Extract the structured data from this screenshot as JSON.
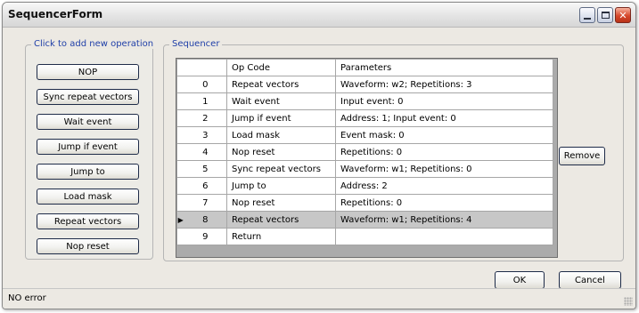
{
  "window": {
    "title": "SequencerForm"
  },
  "operations": {
    "label": "Click to add new operation",
    "buttons": [
      "NOP",
      "Sync repeat vectors",
      "Wait event",
      "Jump if event",
      "Jump to",
      "Load mask",
      "Repeat vectors",
      "Nop reset"
    ]
  },
  "sequencer": {
    "label": "Sequencer",
    "columns": {
      "opcode": "Op Code",
      "parameters": "Parameters"
    },
    "rows": [
      {
        "index": "0",
        "opcode": "Repeat vectors",
        "params": "Waveform: w2; Repetitions: 3"
      },
      {
        "index": "1",
        "opcode": "Wait event",
        "params": "Input event: 0"
      },
      {
        "index": "2",
        "opcode": "Jump if event",
        "params": "Address: 1; Input event: 0"
      },
      {
        "index": "3",
        "opcode": "Load mask",
        "params": "Event mask: 0"
      },
      {
        "index": "4",
        "opcode": "Nop reset",
        "params": "Repetitions: 0"
      },
      {
        "index": "5",
        "opcode": "Sync repeat vectors",
        "params": "Waveform: w1; Repetitions: 0"
      },
      {
        "index": "6",
        "opcode": "Jump to",
        "params": "Address: 2"
      },
      {
        "index": "7",
        "opcode": "Nop reset",
        "params": "Repetitions: 0"
      },
      {
        "index": "8",
        "opcode": "Repeat vectors",
        "params": "Waveform: w1; Repetitions: 4"
      },
      {
        "index": "9",
        "opcode": "Return",
        "params": ""
      }
    ],
    "selected_row": "8",
    "remove_label": "Remove"
  },
  "dialog": {
    "ok_label": "OK",
    "cancel_label": "Cancel"
  },
  "status": {
    "text": "NO error"
  },
  "colors": {
    "group_label": "#1f3fa8",
    "selected_row": "#c7c7c7",
    "close_button": "#d6482c"
  }
}
